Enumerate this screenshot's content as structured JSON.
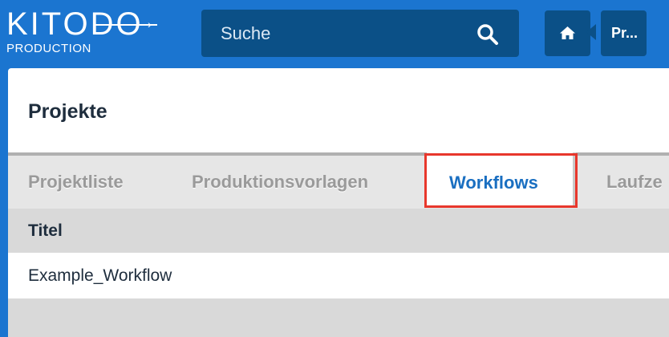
{
  "header": {
    "logo_main": "KITODO",
    "logo_sub": "PRODUCTION",
    "search": {
      "placeholder": "Suche"
    },
    "breadcrumb_label": "Pr..."
  },
  "page": {
    "title": "Projekte"
  },
  "tabs": [
    {
      "label": "Projektliste",
      "active": false
    },
    {
      "label": "Produktionsvorlagen",
      "active": false
    },
    {
      "label": "Workflows",
      "active": true
    },
    {
      "label": "Laufze",
      "active": false
    }
  ],
  "table": {
    "columns": [
      "Titel"
    ],
    "rows": [
      [
        "Example_Workflow"
      ]
    ]
  },
  "colors": {
    "header_bg": "#1b75d0",
    "control_bg": "#0b5087",
    "active_tab_text": "#1a6fc1",
    "highlight_border": "#e8372c"
  },
  "icons": {
    "search": "search-icon",
    "home": "home-icon"
  }
}
